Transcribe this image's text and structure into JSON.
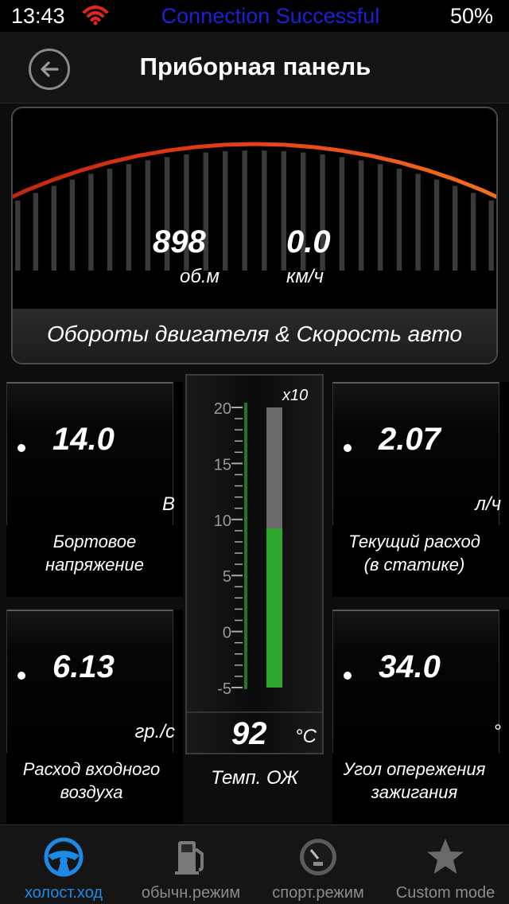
{
  "status_bar": {
    "time": "13:43",
    "message": "Connection Successful",
    "battery": "50%",
    "wifi_icon": "wifi-icon",
    "wifi_color": "#e0261b",
    "message_color": "#1a22d8"
  },
  "nav": {
    "title": "Приборная панель",
    "back_icon": "back-arrow-icon"
  },
  "main_gauge": {
    "rpm_value": "898",
    "rpm_unit": "об.м",
    "speed_value": "0.0",
    "speed_unit": "км/ч",
    "label": "Обороты двигателя & Скорость авто",
    "lit_fraction": 0.13,
    "lit_color": "#e01010",
    "arc_color": "#ff7a10"
  },
  "tiles": {
    "voltage": {
      "value": "14.0",
      "unit": "В",
      "label_line1": "Бортовое",
      "label_line2": "напряжение"
    },
    "fuel_rate": {
      "value": "2.07",
      "unit": "л/ч",
      "label_line1": "Текущий расход",
      "label_line2": "(в статике)"
    },
    "maf": {
      "value": "6.13",
      "unit": "гр./с",
      "label_line1": "Расход входного",
      "label_line2": "воздуха"
    },
    "timing": {
      "value": "34.0",
      "unit": "°",
      "label_line1": "Угол опережения",
      "label_line2": "зажигания"
    }
  },
  "coolant": {
    "value": "92",
    "unit": "°C",
    "multiplier": "x10",
    "label": "Темп. ОЖ",
    "scale_ticks": [
      "20",
      "15",
      "10",
      "5",
      "0",
      "-5"
    ],
    "scale_min": -5,
    "scale_max": 20,
    "reading_x10": 9.2,
    "bar_color": "#2ea82e"
  },
  "tabs": [
    {
      "label": "холост.ход",
      "icon": "steering-wheel-icon",
      "active": true
    },
    {
      "label": "обычн.режим",
      "icon": "fuel-pump-icon",
      "active": false
    },
    {
      "label": "спорт.режим",
      "icon": "speedometer-icon",
      "active": false
    },
    {
      "label": "Custom mode",
      "icon": "star-icon",
      "active": false
    }
  ]
}
